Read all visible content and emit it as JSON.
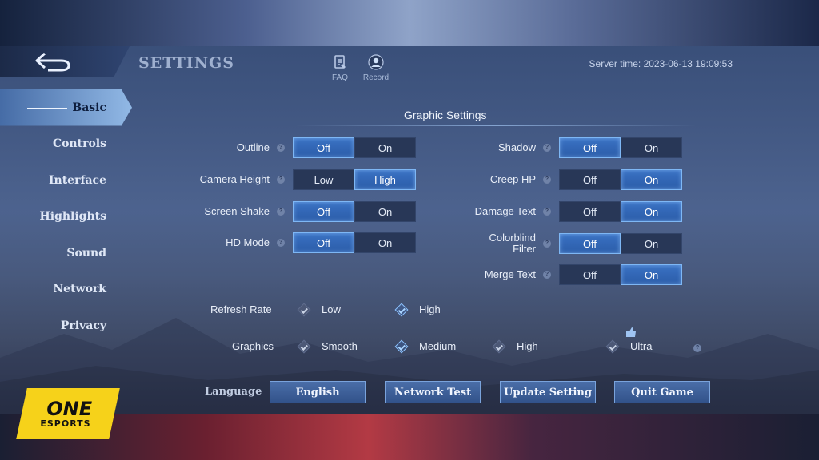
{
  "header": {
    "title": "SETTINGS",
    "faq_label": "FAQ",
    "record_label": "Record",
    "server_time": "Server time: 2023-06-13 19:09:53"
  },
  "sidebar": {
    "items": [
      {
        "label": "Basic",
        "active": true
      },
      {
        "label": "Controls",
        "active": false
      },
      {
        "label": "Interface",
        "active": false
      },
      {
        "label": "Highlights",
        "active": false
      },
      {
        "label": "Sound",
        "active": false
      },
      {
        "label": "Network",
        "active": false
      },
      {
        "label": "Privacy",
        "active": false
      }
    ]
  },
  "section": {
    "title": "Graphic Settings"
  },
  "left_toggles": [
    {
      "label": "Outline",
      "options": [
        "Off",
        "On"
      ],
      "selected": "Off"
    },
    {
      "label": "Camera Height",
      "options": [
        "Low",
        "High"
      ],
      "selected": "High"
    },
    {
      "label": "Screen Shake",
      "options": [
        "Off",
        "On"
      ],
      "selected": "Off"
    },
    {
      "label": "HD Mode",
      "options": [
        "Off",
        "On"
      ],
      "selected": "Off"
    }
  ],
  "right_toggles": [
    {
      "label": "Shadow",
      "options": [
        "Off",
        "On"
      ],
      "selected": "Off"
    },
    {
      "label": "Creep HP",
      "options": [
        "Off",
        "On"
      ],
      "selected": "On"
    },
    {
      "label": "Damage Text",
      "options": [
        "Off",
        "On"
      ],
      "selected": "On"
    },
    {
      "label": "Colorblind Filter",
      "options": [
        "Off",
        "On"
      ],
      "selected": "Off"
    },
    {
      "label": "Merge Text",
      "options": [
        "Off",
        "On"
      ],
      "selected": "On"
    }
  ],
  "refresh_rate": {
    "label": "Refresh Rate",
    "options": [
      "Low",
      "High"
    ],
    "selected": "High"
  },
  "graphics": {
    "label": "Graphics",
    "options": [
      "Smooth",
      "Medium",
      "High",
      "Ultra"
    ],
    "selected": "Medium",
    "recommended": "Ultra"
  },
  "bottom": {
    "language_label": "Language",
    "language_value": "English",
    "network_test": "Network Test",
    "update_setting": "Update Setting",
    "quit_game": "Quit Game"
  },
  "watermark": {
    "line1": "ONE",
    "line2": "ESPORTS"
  },
  "colors": {
    "accent": "#3a72c4",
    "accent_border": "#7eb7f5",
    "logo_yellow": "#f6d21a"
  }
}
